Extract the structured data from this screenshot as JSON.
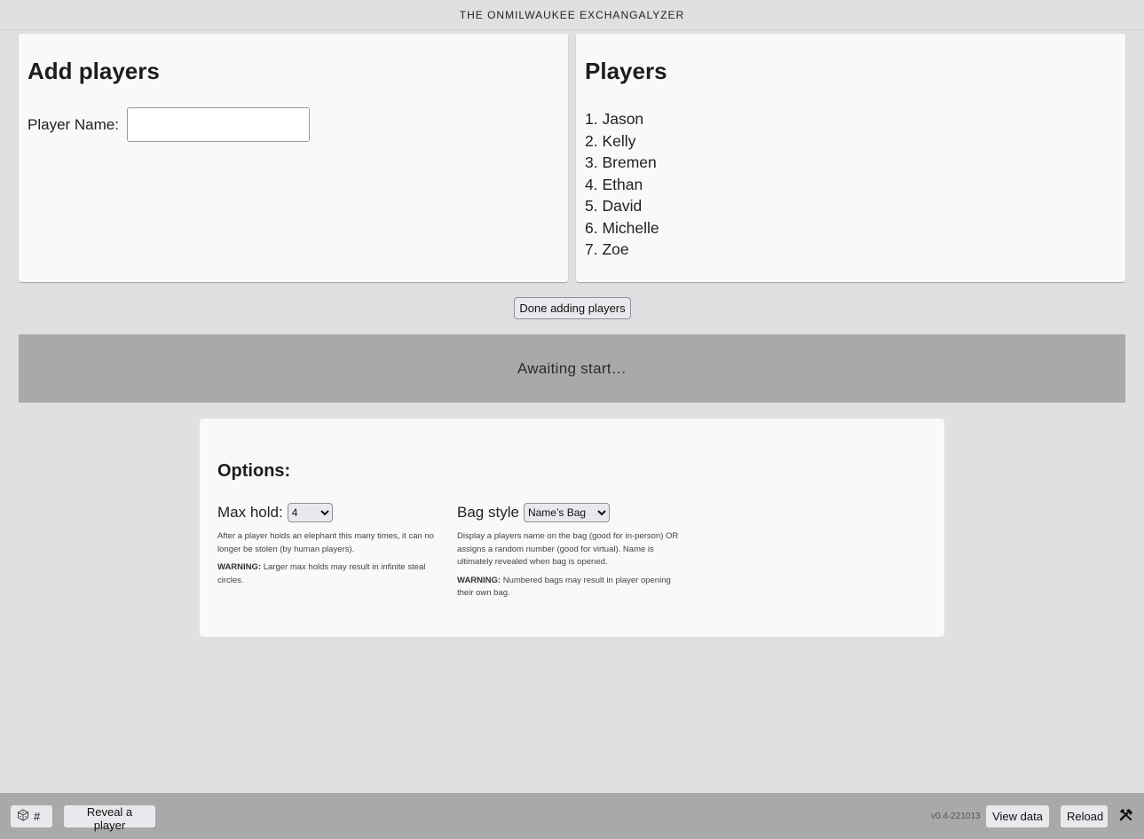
{
  "app": {
    "title": "THE ONMILWAUKEE EXCHANGALYZER"
  },
  "add_players": {
    "heading": "Add players",
    "name_label": "Player Name:",
    "name_value": "",
    "name_placeholder": ""
  },
  "players": {
    "heading": "Players",
    "items": [
      "1. Jason",
      "2. Kelly",
      "3. Bremen",
      "4. Ethan",
      "5. David",
      "6. Michelle",
      "7. Zoe"
    ]
  },
  "done_button": "Done adding players",
  "status": "Awaiting start…",
  "options": {
    "heading": "Options:",
    "max_hold": {
      "label": "Max hold:",
      "selected": "4",
      "description": "After a player holds an elephant this many times, it can no longer be stolen (by human players).",
      "warning_label": "WARNING:",
      "warning_text": " Larger max holds may result in infinite steal circles."
    },
    "bag_style": {
      "label": "Bag style",
      "selected": "Name’s Bag",
      "description": "Display a players name on the bag (good for in-person) OR assigns a random number (good for virtual). Name is ultimately revealed when bag is opened.",
      "warning_label": "WARNING:",
      "warning_text": " Numbered bags may result in player opening their own bag."
    }
  },
  "footer": {
    "dice_icon": "dice-icon",
    "dice_label": "#",
    "reveal_button": "Reveal a player",
    "version": "v0.4-221013",
    "view_data_button": "View data",
    "reload_button": "Reload",
    "tools_icon": "🛠"
  }
}
